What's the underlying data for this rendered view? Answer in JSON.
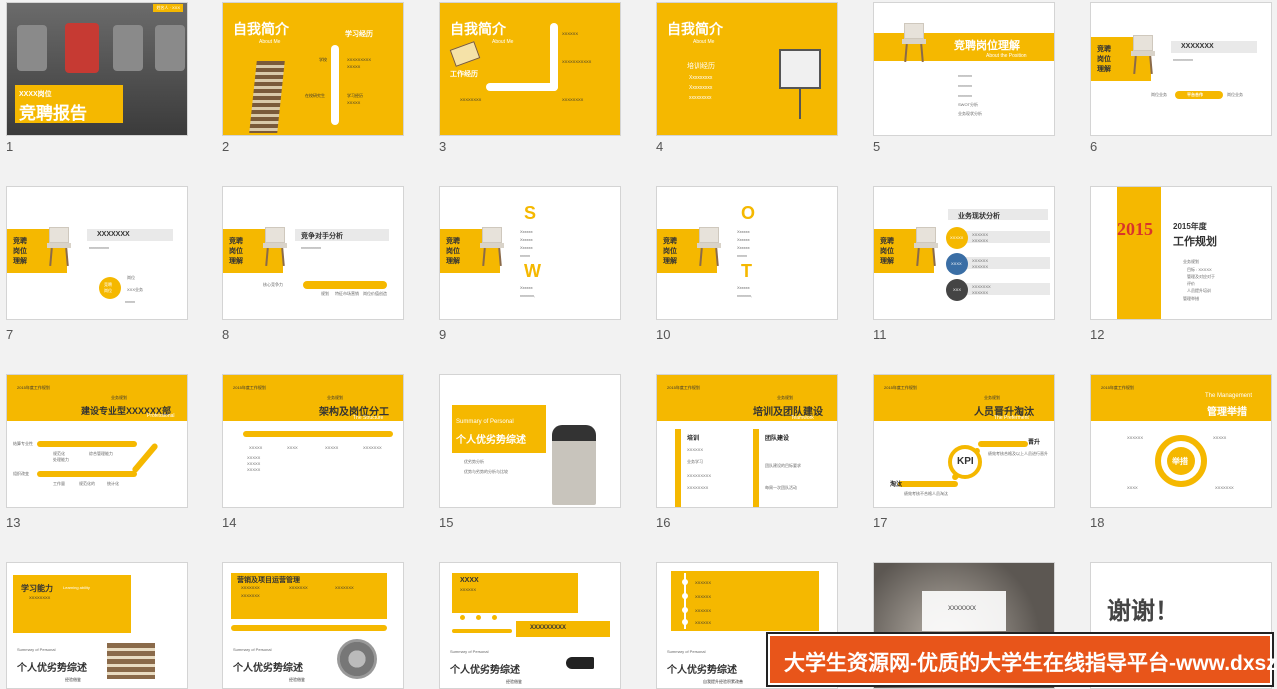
{
  "slides": [
    {
      "num": "1",
      "tag": "姓名人 · XXX",
      "pos": "XXXX岗位",
      "title": "竞聘报告"
    },
    {
      "num": "2",
      "title": "自我简介",
      "sub": "About Me",
      "head": "学习经历",
      "items": [
        "学校",
        "XXXXXXXXX",
        "XXXXX",
        "在校研究生",
        "学习经历",
        "XXXXX"
      ]
    },
    {
      "num": "3",
      "title": "自我简介",
      "sub": "About Me",
      "head": "工作经历",
      "items": [
        "XXXXXX",
        "XXXXXXXXXXX",
        "XXXXXXXX",
        "XXXXXXXX"
      ]
    },
    {
      "num": "4",
      "title": "自我简介",
      "sub": "About Me",
      "head": "培训经历",
      "items": [
        "Xxxxxxxxx",
        "Xxxxxxxxx",
        "xxxxxxxxx"
      ]
    },
    {
      "num": "5",
      "title": "竞聘岗位理解",
      "sub": "About the Position",
      "items": [
        "xxxxxxx",
        "xxxxxxx",
        "xxxxxxx",
        "SWOT分析",
        "业务现状分析"
      ]
    },
    {
      "num": "6",
      "title": "XXXXXXX",
      "side": "竞聘\n岗位\n理解",
      "items": [
        "xxxxxxxxxx"
      ],
      "path": [
        "岗位业务",
        "平台合作",
        "岗位业务"
      ]
    },
    {
      "num": "7",
      "title": "XXXXXXX",
      "side": "竞聘\n岗位\n理解",
      "center": "竞聘\n岗位",
      "items": [
        "xxxxxxxxxx",
        "岗位",
        "XXX业务",
        "xxxxx"
      ]
    },
    {
      "num": "8",
      "title": "竞争对手分析",
      "side": "竞聘\n岗位\n理解",
      "items": [
        "xxxxxxxxxx",
        "核心竞争力",
        "规划",
        "特征市场营销",
        "岗位价值创造"
      ]
    },
    {
      "num": "9",
      "side": "竞聘\n岗位\n理解",
      "letters": [
        "S",
        "W"
      ],
      "items": [
        "Xxxxxx",
        "Xxxxxx",
        "Xxxxxx",
        "xxxxx",
        "Xxxxxx",
        "xxxxxxx,"
      ]
    },
    {
      "num": "10",
      "side": "竞聘\n岗位\n理解",
      "letters": [
        "O",
        "T"
      ],
      "items": [
        "Xxxxxx",
        "Xxxxxx",
        "Xxxxxx",
        "xxxxx",
        "Xxxxxx",
        "xxxxxxx,"
      ]
    },
    {
      "num": "11",
      "title": "业务现状分析",
      "side": "竞聘\n岗位\n理解",
      "circles": [
        "XXXXX",
        "XXXX",
        "XXX"
      ],
      "items": [
        "XXXXXX",
        "XXXXXX",
        "XXXXXX",
        "XXXXXX",
        "XXXXXXX",
        "XXXXXX"
      ]
    },
    {
      "num": "12",
      "year": "2015年度",
      "title": "工作规划",
      "items": [
        "业务规划",
        "目标 : XXXXX",
        "管理及对应对于",
        "评价",
        "人员提升培训",
        "管理举措"
      ]
    },
    {
      "num": "13",
      "top": "2015年度工作规划",
      "small": "业务规划",
      "title": "建设专业型XXXXXX部",
      "en": "Professional",
      "items": [
        "结算专业性",
        "规范化",
        "处理能力",
        "综合管理能力",
        "组织改变",
        "工作量",
        "规范化的",
        "统计化"
      ]
    },
    {
      "num": "14",
      "top": "2015年度工作规划",
      "small": "业务规划",
      "title": "架构及岗位分工",
      "en": "The Structure",
      "cols": [
        "XXXXX",
        "XXXX",
        "XXXXX",
        "XXXXXXX"
      ],
      "items": [
        "XXXXX",
        "XXXXX",
        "XXXXX"
      ]
    },
    {
      "num": "15",
      "en": "Summary of Personal",
      "title": "个人优劣势综述",
      "items": [
        "优劣势分析",
        "优势与劣势的分析与比较"
      ]
    },
    {
      "num": "16",
      "top": "2015年度工作规划",
      "small": "业务规划",
      "title": "培训及团队建设",
      "en": "Teamwork",
      "items": [
        "培训",
        "团队建设",
        "XXXXXX",
        "业务学习",
        "XXXXXXXXX",
        "XXXXXXXX",
        "团队建设的目标要求",
        "每周一次团队活动"
      ]
    },
    {
      "num": "17",
      "top": "2015年度工作规划",
      "small": "业务规划",
      "title": "人员晋升淘汰",
      "en": "The Preferment",
      "kpi": "KPI",
      "items": [
        "晋升",
        "淘汰",
        "绩效考核合格及以上人员进行晋升",
        "绩效考核不合格人员淘汰"
      ]
    },
    {
      "num": "18",
      "top": "2015年度工作规划",
      "en": "The Management",
      "title": "管理举措",
      "center": "举措",
      "items": [
        "XXXXXX",
        "XXXXX",
        "XXXX",
        "XXXXXXX"
      ]
    },
    {
      "num": "19",
      "head": "学习能力",
      "sub": "Learning ability",
      "items": [
        "XXXXXXXX"
      ],
      "en": "Summary of Personal",
      "title": "个人优劣势综述",
      "foot": "经验借鉴"
    },
    {
      "num": "20",
      "head": "营销及项目运营管理",
      "items": [
        "XXXXXXX",
        "XXXXXXX",
        "XXXXXXX",
        "XXXXXXX"
      ],
      "en": "Summary of Personal",
      "title": "个人优劣势综述",
      "foot": "经验借鉴"
    },
    {
      "num": "21",
      "head": "XXXX",
      "items": [
        "XXXXXX",
        "XXXXXXXXX"
      ],
      "en": "Summary of Personal",
      "title": "个人优劣势综述",
      "foot": "经验借鉴"
    },
    {
      "num": "22",
      "items": [
        "XXXXXX",
        "XXXXXX",
        "XXXXXX",
        "XXXXXX"
      ],
      "en": "Summary of Personal",
      "title": "个人优劣势综述",
      "foot": "自我提升经验积累改善"
    },
    {
      "num": "23",
      "box": "XXXXXXX"
    },
    {
      "num": "24",
      "title": "谢谢！"
    }
  ],
  "banner": "大学生资源网-优质的大学生在线指导平台-www.dxszyw.cn",
  "colors": {
    "accent": "#f5b800",
    "banner": "#e8551a"
  }
}
